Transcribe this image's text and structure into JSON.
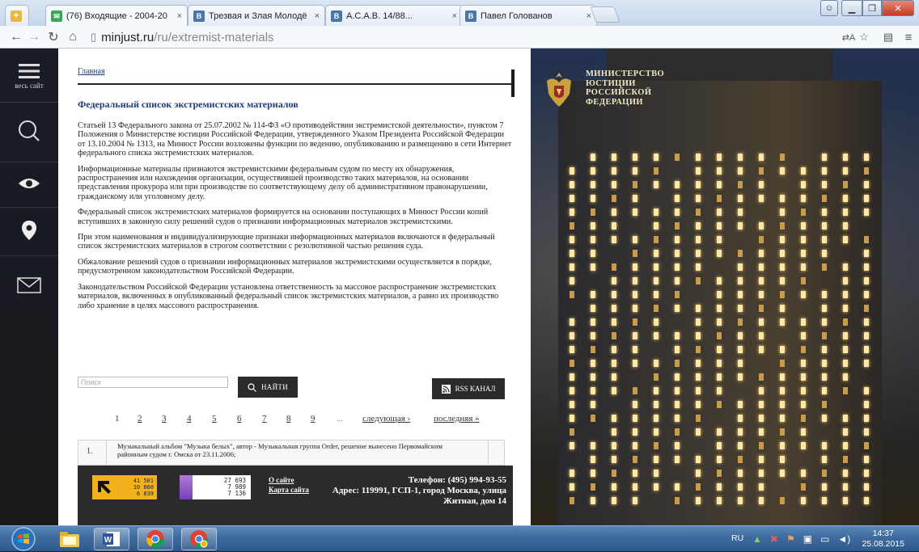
{
  "browser": {
    "tabs": [
      {
        "title": "(76) Входящие - 2004-20",
        "favicon": "mail-icon",
        "color": "#3aa757"
      },
      {
        "title": "Трезвая и Злая Молодё",
        "favicon": "vk-icon",
        "color": "#4a76a8"
      },
      {
        "title": "A.C.A.B. 14/88...",
        "favicon": "vk-icon",
        "color": "#4a76a8"
      },
      {
        "title": "Павел Голованов",
        "favicon": "vk-icon",
        "color": "#4a76a8"
      }
    ],
    "url_host": "minjust.ru",
    "url_path": "/ru/extremist-materials"
  },
  "sidebar": {
    "menu_label": "весь сайт",
    "items": [
      "search-icon",
      "eye-icon",
      "location-pin-icon",
      "mail-icon"
    ]
  },
  "page": {
    "breadcrumb": "Главная",
    "title": "Федеральный список экстремистских материалов",
    "paragraphs": [
      "Статьей 13 Федерального закона от 25.07.2002 № 114-ФЗ «О противодействии экстремистской деятельности», пунктом 7 Положения о Министерстве юстиции Российской Федерации, утвержденного Указом Президента Российской Федерации от 13.10.2004 № 1313, на Минюст России возложены функции по ведению, опубликованию и размещению в сети Интернет федерального списка экстремистских материалов.",
      "Информационные материалы признаются экстремистскими федеральным судом по месту их обнаружения, распространения или нахождения организации, осуществившей производство таких материалов, на основании представления прокурора или при производстве по соответствующему делу об административном правонарушении, гражданскому или уголовному делу.",
      "Федеральный список экстремистских материалов формируется на основании поступающих в Минюст России копий вступивших в законную силу решений судов о признании информационных материалов экстремистскими.",
      "При этом наименования и индивидуализирующие признаки информационных материалов включаются в федеральный список экстремистских материалов в строгом соответствии с резолютивной частью решения суда.",
      "Обжалование решений судов о признании информационных материалов экстремистскими осуществляется в порядке, предусмотренном законодательством Российской Федерации.",
      "Законодательством Российской Федерации установлена ответственность за массовое распространение экстремистских материалов, включенных в опубликованный федеральный список экстремистских материалов, а равно их производство либо хранение в целях массового распространения."
    ],
    "search_placeholder": "Поиск",
    "search_button": "НАЙТИ",
    "rss_button": "RSS КАНАЛ",
    "pager": {
      "pages": [
        "1",
        "2",
        "3",
        "4",
        "5",
        "6",
        "7",
        "8",
        "9",
        "..."
      ],
      "next": "следующая ›",
      "last": "последняя »"
    },
    "first_item": {
      "number": "1.",
      "text": "Музыкальный альбом \"Музыка белых\", автор - Музыкальная группа Order, решение вынесено Первомайским районным судом г. Омска от 23.11.2006;"
    }
  },
  "footer": {
    "counter1": [
      "41 501",
      "10 860",
      "6 839"
    ],
    "counter2": [
      "27 693",
      "7 989",
      "7 136"
    ],
    "links": [
      "О сайте",
      "Карта сайта"
    ],
    "phone": "Телефон: (495) 994-93-55",
    "address_line1": "Адрес: 119991, ГСП-1, город Москва, улица",
    "address_line2": "Житная, дом 14"
  },
  "ministry": {
    "line1": "МИНИСТЕРСТВО",
    "line2": "ЮСТИЦИИ",
    "line3": "РОССИЙСКОЙ",
    "line4": "ФЕДЕРАЦИИ"
  },
  "taskbar": {
    "apps": [
      "windows-explorer-icon",
      "word-icon",
      "chrome-icon",
      "chrome-canary-icon"
    ],
    "lang": "RU",
    "time": "14:37",
    "date": "25.08.2015"
  }
}
